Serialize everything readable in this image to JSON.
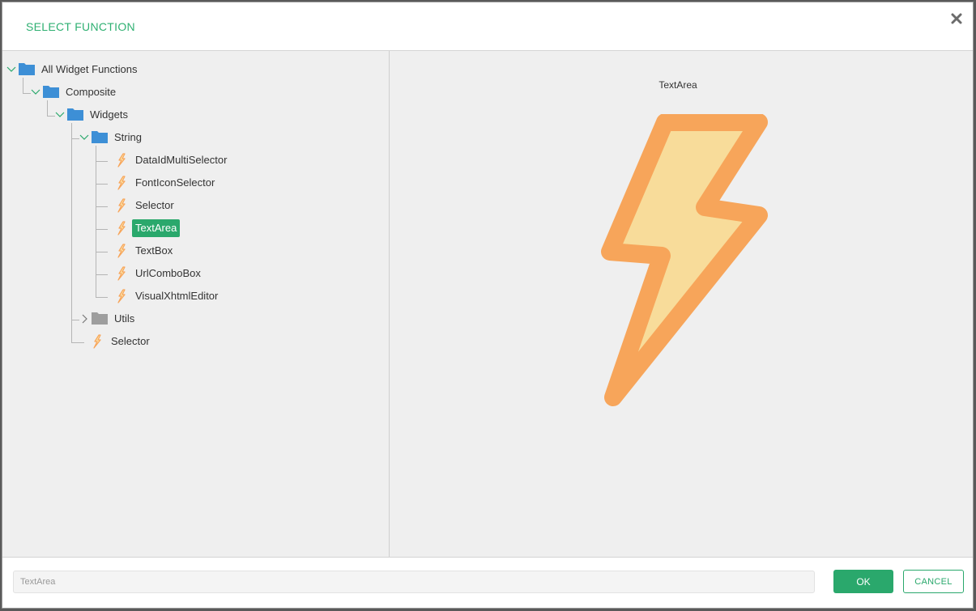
{
  "dialog": {
    "title": "SELECT FUNCTION"
  },
  "colors": {
    "accent": "#2aa86c",
    "title": "#2fb072",
    "folder_open": "#3d8fd6",
    "folder_closed": "#9e9e9e",
    "bolt_stroke": "#f7a55a",
    "bolt_fill": "#f8dc9a"
  },
  "tree": {
    "nodes": [
      {
        "label": "All Widget Functions",
        "icon": "folder-icon",
        "state": "expanded"
      },
      {
        "label": "Composite",
        "icon": "folder-icon",
        "state": "expanded"
      },
      {
        "label": "Widgets",
        "icon": "folder-icon",
        "state": "expanded"
      },
      {
        "label": "String",
        "icon": "folder-icon",
        "state": "expanded"
      },
      {
        "label": "DataIdMultiSelector",
        "icon": "lightning-icon"
      },
      {
        "label": "FontIconSelector",
        "icon": "lightning-icon"
      },
      {
        "label": "Selector",
        "icon": "lightning-icon"
      },
      {
        "label": "TextArea",
        "icon": "lightning-icon",
        "selected": true
      },
      {
        "label": "TextBox",
        "icon": "lightning-icon"
      },
      {
        "label": "UrlComboBox",
        "icon": "lightning-icon"
      },
      {
        "label": "VisualXhtmlEditor",
        "icon": "lightning-icon"
      },
      {
        "label": "Utils",
        "icon": "folder-icon",
        "state": "collapsed"
      },
      {
        "label": "Selector",
        "icon": "lightning-icon"
      }
    ]
  },
  "preview": {
    "name": "TextArea",
    "icon": "lightning-icon"
  },
  "footer": {
    "selected_value": "TextArea",
    "ok_label": "OK",
    "cancel_label": "CANCEL"
  }
}
